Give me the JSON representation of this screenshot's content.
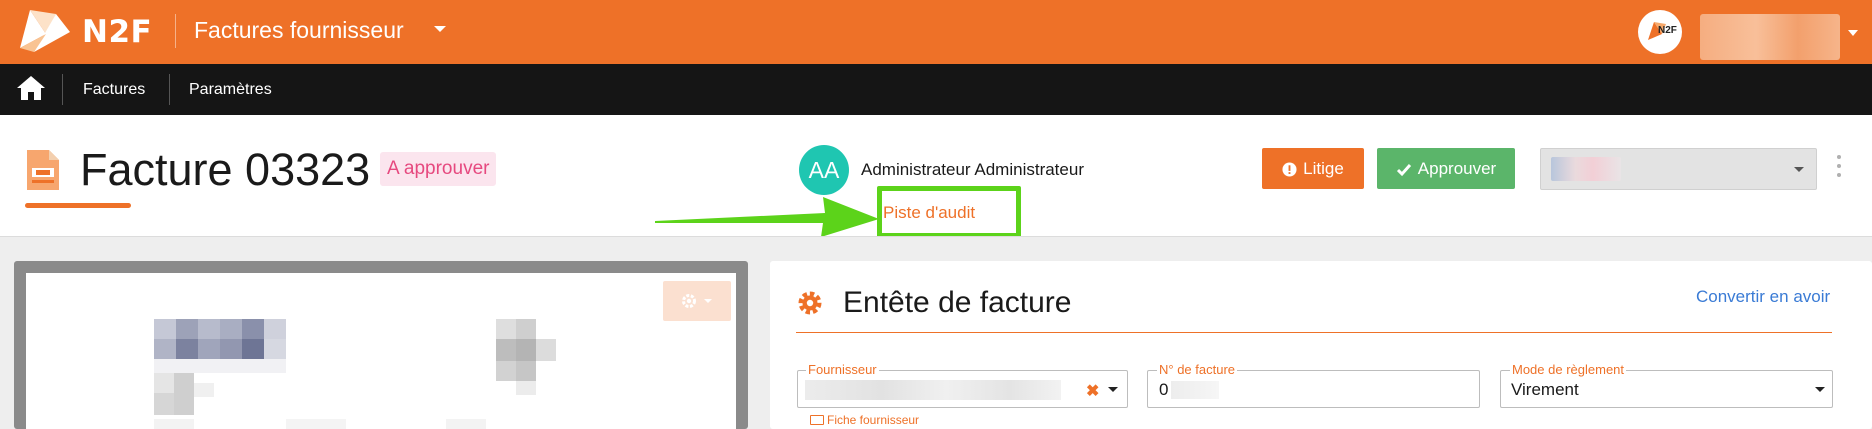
{
  "topbar": {
    "brand": "N2F",
    "app_title": "Factures fournisseur",
    "avatar_text": "N2F"
  },
  "nav": {
    "items": [
      {
        "label": "Factures"
      },
      {
        "label": "Paramètres"
      }
    ]
  },
  "invoice": {
    "title": "Facture 03323",
    "status": "A approuver"
  },
  "approver": {
    "initials": "AA",
    "name": "Administrateur Administrateur",
    "audit_link": "Piste d'audit"
  },
  "actions": {
    "litige_label": "Litige",
    "approve_label": "Approuver"
  },
  "section": {
    "title": "Entête de facture",
    "convert_link": "Convertir en avoir"
  },
  "form": {
    "supplier_label": "Fournisseur",
    "supplier_sheet_link": "Fiche fournisseur",
    "invoice_number_label": "N° de facture",
    "invoice_number_value": "0",
    "payment_mode_label": "Mode de règlement",
    "payment_mode_value": "Virement"
  },
  "colors": {
    "brand_orange": "#ee7128",
    "nav_black": "#151515",
    "approve_green": "#5bb56a",
    "avatar_teal": "#1fc6b1",
    "status_pink": "#e6497f",
    "highlight_green": "#5cd31a",
    "link_blue": "#3a7bd5"
  },
  "icons": [
    "n2f-logo-icon",
    "home-icon",
    "document-icon",
    "exclamation-circle-icon",
    "check-icon",
    "gear-icon",
    "close-icon",
    "chevron-down-icon",
    "id-card-icon",
    "arrow-right-icon"
  ]
}
